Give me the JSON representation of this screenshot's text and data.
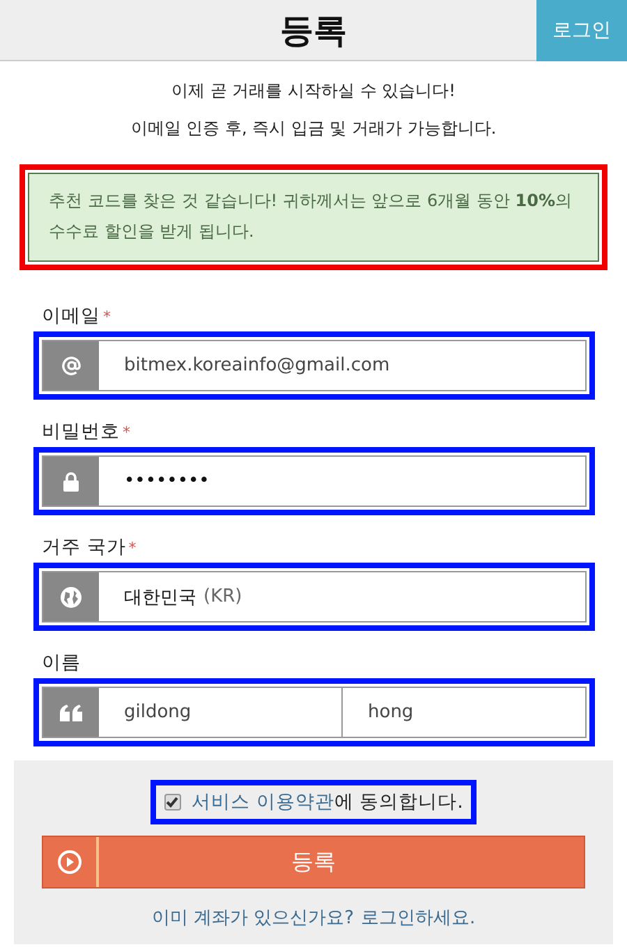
{
  "header": {
    "title": "등록",
    "login_button": "로그인"
  },
  "intro": [
    "이제 곧 거래를 시작하실 수 있습니다!",
    "이메일 인증 후, 즉시 입금 및 거래가 가능합니다."
  ],
  "notice": {
    "text": "추천 코드를 찾은 것 같습니다! 귀하께서는 앞으로 6개월 동안 **10%**의 수수료 할인을 받게 됩니다.",
    "highlighted": true
  },
  "fields": [
    {
      "kind": "email",
      "label": "이메일",
      "required_mark": "*",
      "value": "bitmex.koreainfo@gmail.com",
      "highlighted": true
    },
    {
      "kind": "password",
      "label": "비밀번호",
      "required_mark": "*",
      "value": "••••••••",
      "highlighted": true
    },
    {
      "kind": "country",
      "label": "거주 국가",
      "required_mark": "*",
      "value": "대한민국",
      "suffix": "(KR)",
      "highlighted": true
    },
    {
      "kind": "name",
      "label": "이름",
      "value": "gildong",
      "value_2": "hong",
      "highlighted": true
    }
  ],
  "terms": {
    "checked": true,
    "link": "서비스 이용약관",
    "text": "에 동의합니다.",
    "highlighted": true
  },
  "submit": "등록",
  "login_prompt": {
    "text": "이미 계좌가 있으신가요?",
    "link": "로그인하세요."
  }
}
